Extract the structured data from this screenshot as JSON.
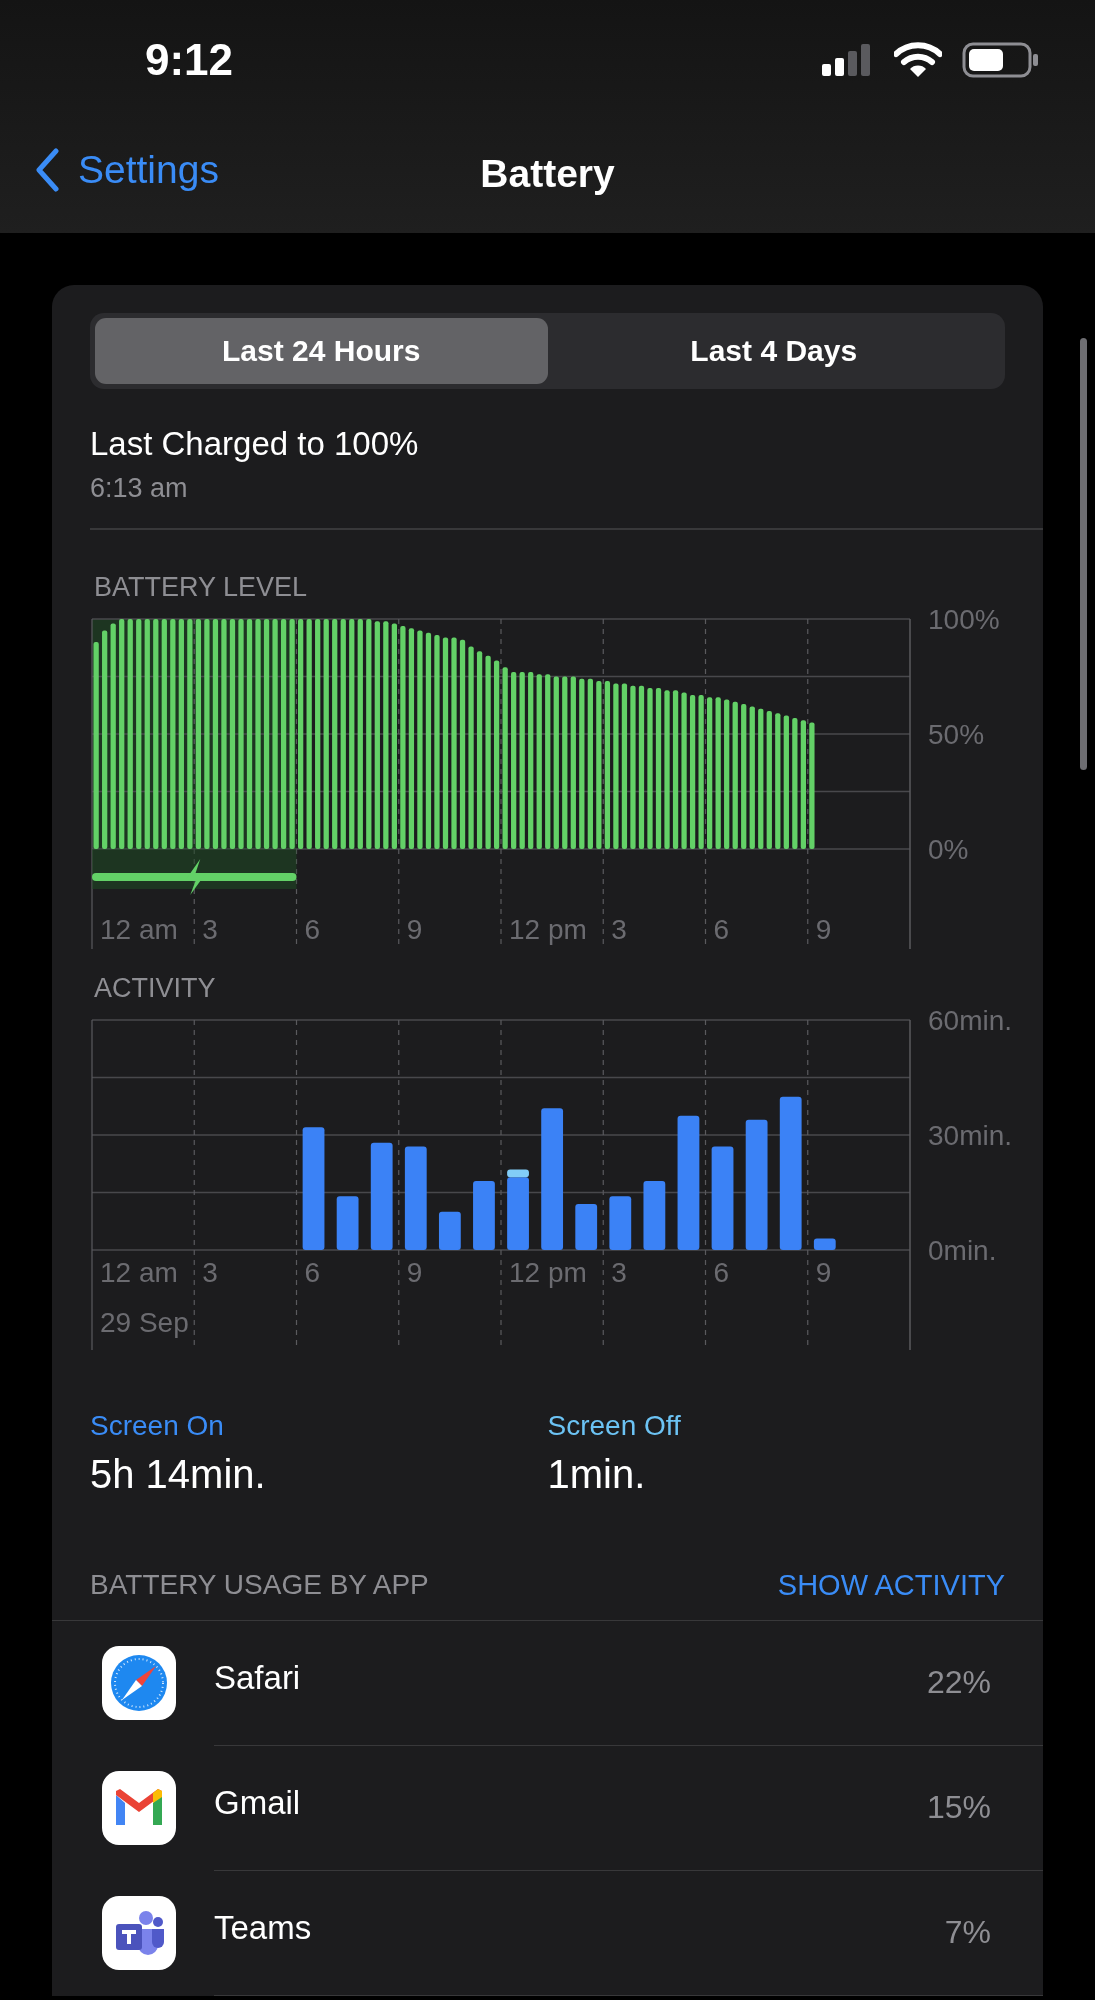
{
  "status_bar": {
    "time": "9:12"
  },
  "nav": {
    "back_label": "Settings",
    "title": "Battery"
  },
  "tabs": [
    {
      "label": "Last 24 Hours",
      "selected": true
    },
    {
      "label": "Last 4 Days",
      "selected": false
    }
  ],
  "last_charged": {
    "title": "Last Charged to 100%",
    "time": "6:13 am"
  },
  "battery_level": {
    "title": "BATTERY LEVEL",
    "chart_data": {
      "type": "bar",
      "ylim": [
        0,
        100
      ],
      "categories": [
        null,
        null,
        null,
        null,
        null,
        null,
        null,
        null,
        null,
        null,
        null,
        null,
        null,
        null,
        null,
        null,
        null,
        null,
        null,
        null,
        null,
        null,
        null,
        null,
        null,
        null,
        null,
        null,
        null,
        null,
        null,
        null,
        null,
        null,
        null,
        null,
        null,
        null,
        null,
        null,
        null,
        null,
        null,
        null,
        null,
        null,
        null,
        null,
        null,
        null,
        null,
        null,
        null,
        null,
        null,
        null,
        null,
        null,
        null,
        null,
        null,
        null,
        null,
        null,
        null,
        null,
        null,
        null,
        null,
        null,
        null,
        null,
        null,
        null,
        null,
        null,
        null,
        null,
        null,
        null,
        null,
        null,
        null,
        null,
        null
      ],
      "series": [
        {
          "color": "#63d167",
          "values": [
            90,
            95,
            98,
            100,
            100,
            100,
            100,
            100,
            100,
            100,
            100,
            100,
            100,
            100,
            100,
            100,
            100,
            100,
            100,
            100,
            100,
            100,
            100,
            100,
            100,
            100,
            100,
            100,
            100,
            100,
            100,
            100,
            100,
            99,
            99,
            98,
            97,
            96,
            95,
            94,
            93,
            92,
            92,
            91,
            88,
            86,
            84,
            82,
            79,
            77,
            77,
            77,
            76,
            76,
            75,
            75,
            75,
            74,
            74,
            73,
            73,
            72,
            72,
            71,
            71,
            70,
            70,
            69,
            69,
            68,
            67,
            67,
            66,
            66,
            65,
            64,
            63,
            62,
            61,
            60,
            59,
            58,
            57,
            56,
            55
          ]
        }
      ],
      "yticks": [
        {
          "value": 100,
          "label": "100%"
        },
        {
          "value": 50,
          "label": "50%"
        },
        {
          "value": 0,
          "label": "0%"
        }
      ]
    },
    "charging_indicator": {
      "level": 0.25
    },
    "hour_labels": [
      "12 am",
      "3",
      "6",
      "9",
      "12 pm",
      "3",
      "6",
      "9"
    ]
  },
  "activity": {
    "title": "ACTIVITY",
    "chart_data": {
      "type": "bar",
      "stacked": true,
      "ylim": [
        0,
        60
      ],
      "categories": [
        null,
        null,
        null,
        null,
        null,
        null,
        null,
        null,
        null,
        null,
        null,
        null,
        null,
        null,
        null,
        null
      ],
      "series": [
        {
          "color": "#3b82f6",
          "values": [
            32,
            14,
            28,
            27,
            10,
            18,
            19,
            37,
            12,
            14,
            18,
            35,
            27,
            34,
            40,
            3
          ]
        },
        {
          "color": "#82cdf7",
          "values": [
            0,
            0,
            0,
            0,
            0,
            0,
            2,
            0,
            0,
            0,
            0,
            0,
            0,
            0,
            0,
            0
          ]
        }
      ],
      "yticks": [
        {
          "value": 60,
          "label": "60min."
        },
        {
          "value": 30,
          "label": "30min."
        },
        {
          "value": 0,
          "label": "0min."
        }
      ]
    },
    "hour_labels": [
      "12 am",
      "3",
      "6",
      "9",
      "12 pm",
      "3",
      "6",
      "9"
    ],
    "date_label": "29 Sep"
  },
  "screen_time": [
    {
      "label": "Screen On",
      "value": "5h 14min.",
      "color": "#3a8cf6"
    },
    {
      "label": "Screen Off",
      "value": "1min.",
      "color": "#6cc3f4"
    }
  ],
  "usage": {
    "title": "BATTERY USAGE BY APP",
    "action": "SHOW ACTIVITY",
    "apps": [
      {
        "name": "Safari",
        "kind": "safari",
        "percent": "22%"
      },
      {
        "name": "Gmail",
        "kind": "gmail",
        "percent": "15%"
      },
      {
        "name": "Teams",
        "kind": "teams",
        "percent": "7%"
      }
    ]
  }
}
